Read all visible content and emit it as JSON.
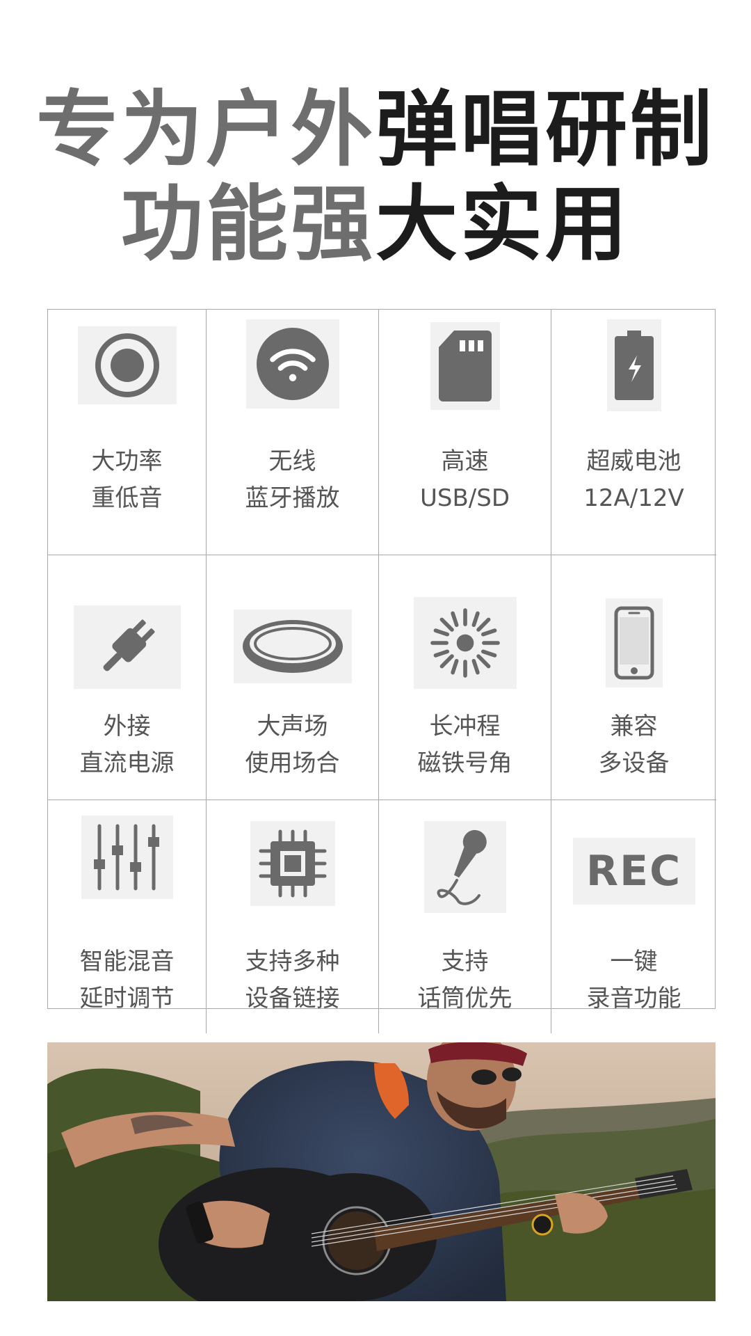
{
  "headline": {
    "line1_grey": "专为户外",
    "line1_dark": "弹唱研制",
    "line2_grey": "功能强",
    "line2_dark": "大实用"
  },
  "features": [
    {
      "icon": "record-circle-icon",
      "line1": "大功率",
      "line2": "重低音"
    },
    {
      "icon": "wifi-icon",
      "line1": "无线",
      "line2": "蓝牙播放"
    },
    {
      "icon": "sd-card-icon",
      "line1": "高速",
      "line2": "USB/SD"
    },
    {
      "icon": "battery-icon",
      "line1": "超威电池",
      "line2": "12A/12V"
    },
    {
      "icon": "power-plug-icon",
      "line1": "外接",
      "line2": "直流电源"
    },
    {
      "icon": "sound-field-disc-icon",
      "line1": "大声场",
      "line2": "使用场合"
    },
    {
      "icon": "sunburst-icon",
      "line1": "长冲程",
      "line2": "磁铁号角"
    },
    {
      "icon": "smartphone-icon",
      "line1": "兼容",
      "line2": "多设备"
    },
    {
      "icon": "mixer-sliders-icon",
      "line1": "智能混音",
      "line2": "延时调节"
    },
    {
      "icon": "chip-icon",
      "line1": "支持多种",
      "line2": "设备链接"
    },
    {
      "icon": "microphone-icon",
      "line1": "支持",
      "line2": "话筒优先"
    },
    {
      "icon": "rec-icon",
      "line1": "一键",
      "line2": "录音功能",
      "icon_text": "REC"
    }
  ],
  "colors": {
    "headline_grey": "#6e6e6e",
    "headline_dark": "#1c1c1c",
    "icon_grey": "#6a6a6a",
    "label_grey": "#555555",
    "grid_line": "#a8a8a8"
  },
  "photo": {
    "subject": "guitarist-outdoor-photo"
  }
}
